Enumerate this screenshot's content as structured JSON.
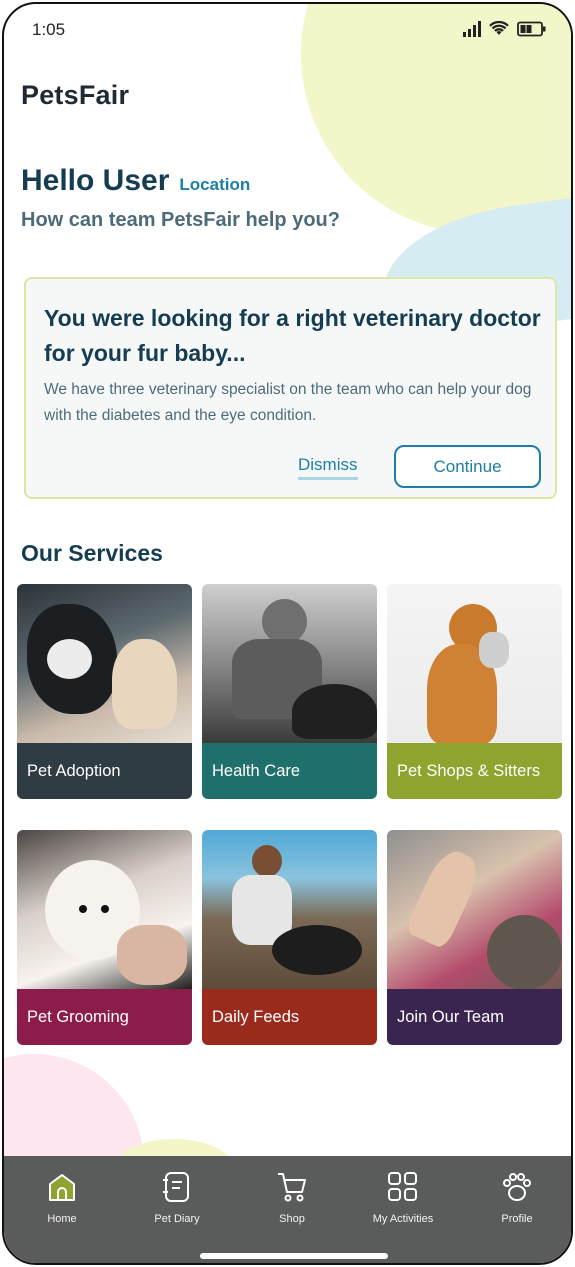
{
  "status_bar": {
    "time": "1:05"
  },
  "app": {
    "name": "PetsFair"
  },
  "greeting": {
    "title": "Hello User",
    "location": "Location",
    "subtitle": "How can team PetsFair help you?"
  },
  "suggestion_card": {
    "title": "You were looking for a right veterinary doctor for your fur baby...",
    "body": "We have three veterinary specialist on the team who can help your dog with the diabetes and the eye condition.",
    "dismiss_label": "Dismiss",
    "continue_label": "Continue"
  },
  "services": {
    "title": "Our Services",
    "items": [
      {
        "label": "Pet Adoption",
        "color": "#2f3c44"
      },
      {
        "label": "Health Care",
        "color": "#1f6f6c"
      },
      {
        "label": "Pet Shops & Sitters",
        "color": "#8da42e"
      },
      {
        "label": "Pet Grooming",
        "color": "#8c1d4a"
      },
      {
        "label": "Daily Feeds",
        "color": "#9a2a1c"
      },
      {
        "label": "Join Our Team",
        "color": "#3a2450"
      }
    ]
  },
  "nav": {
    "items": [
      {
        "label": "Home",
        "icon": "home-icon",
        "active": true
      },
      {
        "label": "Pet Diary",
        "icon": "diary-icon"
      },
      {
        "label": "Shop",
        "icon": "cart-icon"
      },
      {
        "label": "My Activities",
        "icon": "grid-icon"
      },
      {
        "label": "Profile",
        "icon": "paw-icon"
      }
    ],
    "active_color": "#8da42e"
  }
}
